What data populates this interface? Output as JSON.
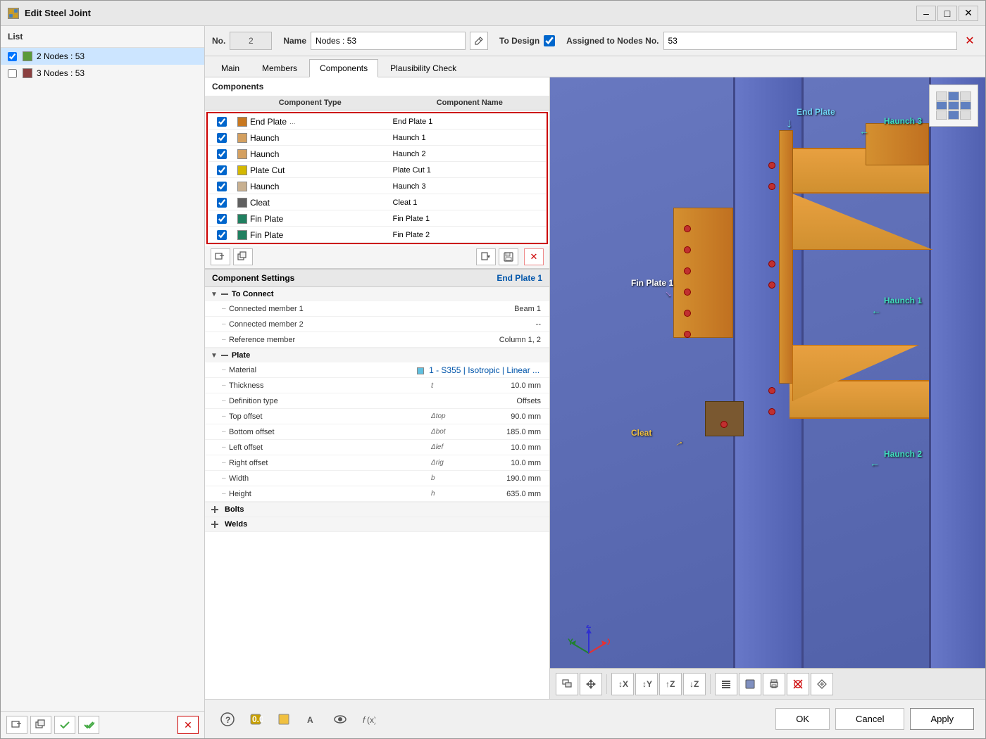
{
  "window": {
    "title": "Edit Steel Joint",
    "minimize_label": "–",
    "maximize_label": "□",
    "close_label": "✕"
  },
  "header": {
    "no_label": "No.",
    "no_value": "2",
    "name_label": "Name",
    "name_value": "Nodes : 53",
    "to_design_label": "To Design",
    "assigned_label": "Assigned to Nodes No.",
    "assigned_value": "53"
  },
  "tabs": [
    {
      "label": "Main",
      "active": false
    },
    {
      "label": "Members",
      "active": false
    },
    {
      "label": "Components",
      "active": true
    },
    {
      "label": "Plausibility Check",
      "active": false
    }
  ],
  "left_panel": {
    "header": "List",
    "nodes": [
      {
        "id": 2,
        "label": "2 Nodes : 53",
        "color": "#5a9a3a",
        "selected": true
      },
      {
        "id": 3,
        "label": "3 Nodes : 53",
        "color": "#8b4040",
        "selected": false
      }
    ]
  },
  "components_section": {
    "header": "Components",
    "col_type": "Component Type",
    "col_name": "Component Name",
    "rows": [
      {
        "checked": true,
        "color": "#c87820",
        "type": "End Plate",
        "has_dots": true,
        "name": "End Plate 1",
        "selected": true
      },
      {
        "checked": true,
        "color": "#d4a060",
        "type": "Haunch",
        "has_dots": false,
        "name": "Haunch 1",
        "selected": false
      },
      {
        "checked": true,
        "color": "#d4a060",
        "type": "Haunch",
        "has_dots": false,
        "name": "Haunch 2",
        "selected": false
      },
      {
        "checked": true,
        "color": "#d4b800",
        "type": "Plate Cut",
        "has_dots": false,
        "name": "Plate Cut 1",
        "selected": false
      },
      {
        "checked": true,
        "color": "#c8b090",
        "type": "Haunch",
        "has_dots": false,
        "name": "Haunch 3",
        "selected": false
      },
      {
        "checked": true,
        "color": "#606060",
        "type": "Cleat",
        "has_dots": false,
        "name": "Cleat 1",
        "selected": false
      },
      {
        "checked": true,
        "color": "#208060",
        "type": "Fin Plate",
        "has_dots": false,
        "name": "Fin Plate 1",
        "selected": false
      },
      {
        "checked": true,
        "color": "#208060",
        "type": "Fin Plate",
        "has_dots": false,
        "name": "Fin Plate 2",
        "selected": false
      }
    ],
    "toolbar": {
      "add_icon": "⬅",
      "duplicate_icon": "⬅",
      "import_icon": "⤵",
      "save_icon": "💾",
      "delete_icon": "✕"
    }
  },
  "settings": {
    "header": "Component Settings",
    "component_name": "End Plate 1",
    "groups": [
      {
        "label": "To Connect",
        "expanded": true,
        "rows": [
          {
            "dash": "–",
            "label": "Connected member 1",
            "symbol": "",
            "value": "Beam 1"
          },
          {
            "dash": "–",
            "label": "Connected member 2",
            "symbol": "",
            "value": "--"
          },
          {
            "dash": "–",
            "label": "Reference member",
            "symbol": "",
            "value": "Column 1, 2"
          }
        ]
      },
      {
        "label": "Plate",
        "expanded": true,
        "rows": [
          {
            "dash": "–",
            "label": "Material",
            "symbol": "",
            "value": "1 - S355 | Isotropic | Linear ...",
            "is_link": true
          },
          {
            "dash": "–",
            "label": "Thickness",
            "symbol": "t",
            "value": "10.0  mm"
          },
          {
            "dash": "–",
            "label": "Definition type",
            "symbol": "",
            "value": "Offsets"
          },
          {
            "dash": "–",
            "label": "Top offset",
            "symbol": "Δtop",
            "value": "90.0  mm"
          },
          {
            "dash": "–",
            "label": "Bottom offset",
            "symbol": "Δbot",
            "value": "185.0  mm"
          },
          {
            "dash": "–",
            "label": "Left offset",
            "symbol": "Δlef",
            "value": "10.0  mm"
          },
          {
            "dash": "–",
            "label": "Right offset",
            "symbol": "Δrig",
            "value": "10.0  mm"
          },
          {
            "dash": "–",
            "label": "Width",
            "symbol": "b",
            "value": "190.0  mm"
          },
          {
            "dash": "–",
            "label": "Height",
            "symbol": "h",
            "value": "635.0  mm"
          }
        ]
      },
      {
        "label": "Bolts",
        "expanded": false,
        "rows": []
      },
      {
        "label": "Welds",
        "expanded": false,
        "rows": []
      }
    ]
  },
  "view_3d": {
    "labels": {
      "end_plate": "End Plate",
      "haunch3": "Haunch 3",
      "fin_plate1": "Fin Plate 1",
      "haunch1": "Haunch 1",
      "cleat": "Cleat",
      "haunch2": "Haunch 2"
    }
  },
  "bottom_bar": {
    "ok_label": "OK",
    "cancel_label": "Cancel",
    "apply_label": "Apply"
  },
  "toolbar_3d": {
    "buttons": [
      "⊕",
      "↕",
      "←",
      "→↑",
      "↑↓",
      "↑Z",
      "↓Z",
      "◧",
      "⬜",
      "🖨",
      "✕✕",
      "↗"
    ]
  }
}
